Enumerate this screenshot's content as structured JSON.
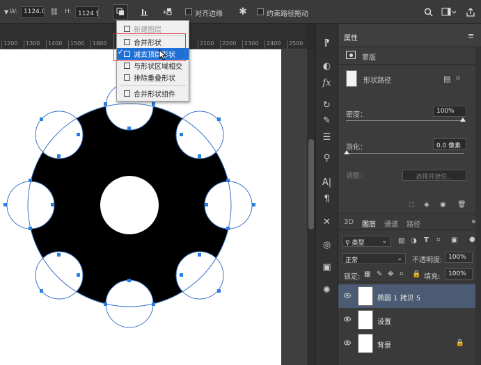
{
  "optionsbar": {
    "w_label": "W:",
    "w_value": "1124.0",
    "h_label": "H:",
    "h_value": "1124 像",
    "align_edges_label": "对齐边缘",
    "constrain_path_label": "约束路径拖动"
  },
  "ruler": {
    "labels": [
      "1200",
      "1300",
      "1400",
      "1500",
      "1600",
      "2100",
      "2200",
      "2300",
      "2400",
      "2500"
    ]
  },
  "dropdown": {
    "items": [
      {
        "label": "新建图层",
        "state": "disabled"
      },
      {
        "label": "合并形状",
        "state": "normal"
      },
      {
        "label": "减去顶层形状",
        "state": "selected"
      },
      {
        "label": "与形状区域相交",
        "state": "normal"
      },
      {
        "label": "排除重叠形状",
        "state": "normal"
      },
      {
        "label": "合并形状组件",
        "state": "normal"
      }
    ],
    "check_mark": "✓"
  },
  "properties": {
    "tab_label": "属性",
    "mask_label": "蒙版",
    "shape_path_label": "形状路径",
    "density_label": "密度：",
    "density_value": "100%",
    "feather_label": "羽化：",
    "feather_value": "0.0 像素",
    "adjust_label": "调整：",
    "select_mask_button": "选择并遮住..."
  },
  "layers": {
    "tabs": [
      "3D",
      "图层",
      "通道",
      "路径"
    ],
    "active_tab": "图层",
    "filter_label": "类型",
    "blend_mode": "正常",
    "opacity_label": "不透明度:",
    "opacity_value": "100%",
    "lock_label": "锁定:",
    "fill_label": "填充:",
    "fill_value": "100%",
    "items": [
      {
        "name": "椭圆 1 拷贝 5",
        "active": true
      },
      {
        "name": "设置",
        "active": false
      },
      {
        "name": "背景",
        "active": false,
        "locked": true
      }
    ]
  },
  "colors": {
    "selection": "#1e6fd6",
    "path_stroke": "#3a72c4",
    "anchor": "#2a7de1",
    "highlight_box": "#e0393e",
    "active_layer": "#4b5b73"
  }
}
